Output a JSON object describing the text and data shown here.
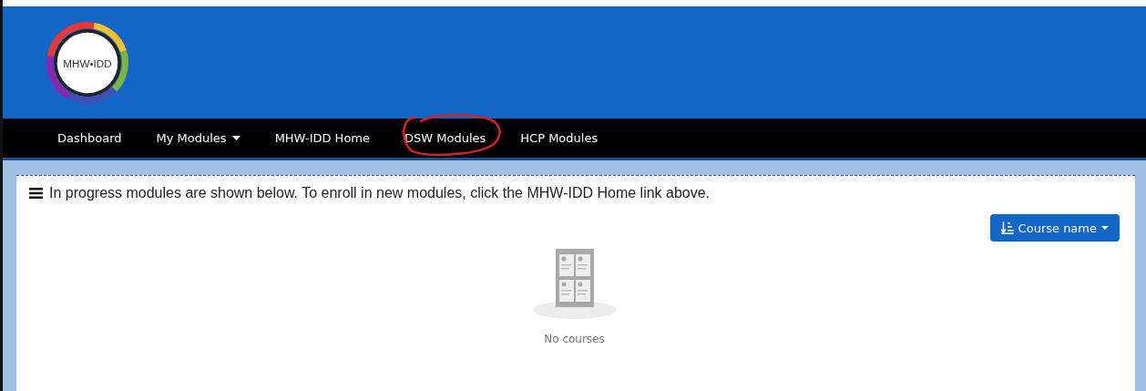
{
  "logo": {
    "text": "MHW•IDD"
  },
  "nav": [
    {
      "label": "Dashboard",
      "dropdown": false,
      "circled": false
    },
    {
      "label": "My Modules",
      "dropdown": true,
      "circled": false
    },
    {
      "label": "MHW-IDD Home",
      "dropdown": false,
      "circled": false
    },
    {
      "label": "DSW Modules",
      "dropdown": false,
      "circled": true
    },
    {
      "label": "HCP Modules",
      "dropdown": false,
      "circled": false
    }
  ],
  "notice": "In progress modules are shown below. To enroll in new modules, click the MHW-IDD Home link above.",
  "sort_button": {
    "label": "Course name"
  },
  "empty_state": {
    "message": "No courses"
  }
}
